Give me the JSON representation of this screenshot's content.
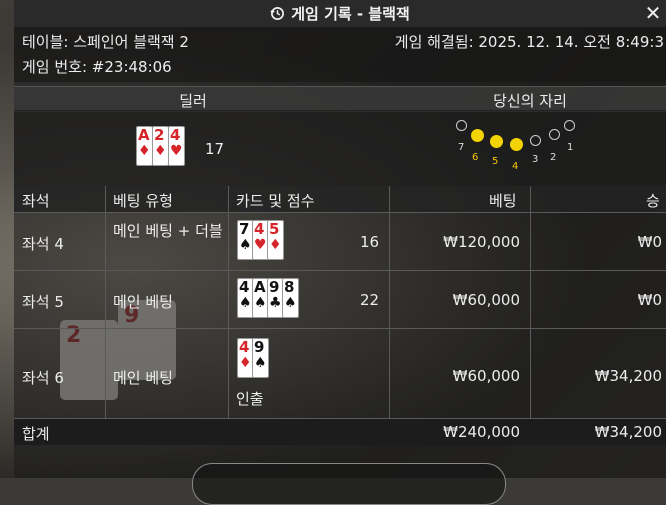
{
  "title": "게임 기록 - 블랙잭",
  "info": {
    "table": "테이블: 스페인어 블랙잭 2",
    "resolved": "게임 해결됨: 2025. 12. 14. 오전 8:49:3",
    "game_no": "게임 번호: #23:48:06"
  },
  "sections": {
    "dealer": "딜러",
    "your_seat": "당신의 자리"
  },
  "dealer": {
    "cards": [
      {
        "rank": "A",
        "suit": "♦",
        "color": "red"
      },
      {
        "rank": "2",
        "suit": "♦",
        "color": "red"
      },
      {
        "rank": "4",
        "suit": "♥",
        "color": "red"
      }
    ],
    "score": "17"
  },
  "seats": [
    {
      "num": "7",
      "mine": false
    },
    {
      "num": "6",
      "mine": true
    },
    {
      "num": "5",
      "mine": true
    },
    {
      "num": "4",
      "mine": true
    },
    {
      "num": "3",
      "mine": false
    },
    {
      "num": "2",
      "mine": false
    },
    {
      "num": "1",
      "mine": false
    }
  ],
  "table_headers": {
    "seat": "좌석",
    "bet_type": "베팅 유형",
    "cards": "카드 및 점수",
    "bet": "베팅",
    "win": "승"
  },
  "rows": [
    {
      "seat": "좌석 4",
      "bet_type": "메인 베팅 + 더블",
      "score": "16",
      "bet": "₩120,000",
      "win": "₩0",
      "note": "",
      "cards": [
        {
          "rank": "7",
          "suit": "♠",
          "color": "black"
        },
        {
          "rank": "4",
          "suit": "♥",
          "color": "red"
        },
        {
          "rank": "5",
          "suit": "♦",
          "color": "red"
        }
      ]
    },
    {
      "seat": "좌석 5",
      "bet_type": "메인 베팅",
      "score": "22",
      "bet": "₩60,000",
      "win": "₩0",
      "note": "",
      "cards": [
        {
          "rank": "4",
          "suit": "♠",
          "color": "black"
        },
        {
          "rank": "A",
          "suit": "♠",
          "color": "black"
        },
        {
          "rank": "9",
          "suit": "♣",
          "color": "black"
        },
        {
          "rank": "8",
          "suit": "♠",
          "color": "black"
        }
      ]
    },
    {
      "seat": "좌석 6",
      "bet_type": "메인 베팅",
      "score": "",
      "bet": "₩60,000",
      "win": "₩34,200",
      "note": "인출",
      "cards": [
        {
          "rank": "4",
          "suit": "♦",
          "color": "red"
        },
        {
          "rank": "9",
          "suit": "♠",
          "color": "black"
        }
      ]
    }
  ],
  "total": {
    "label": "합계",
    "bet": "₩240,000",
    "win": "₩34,200"
  }
}
